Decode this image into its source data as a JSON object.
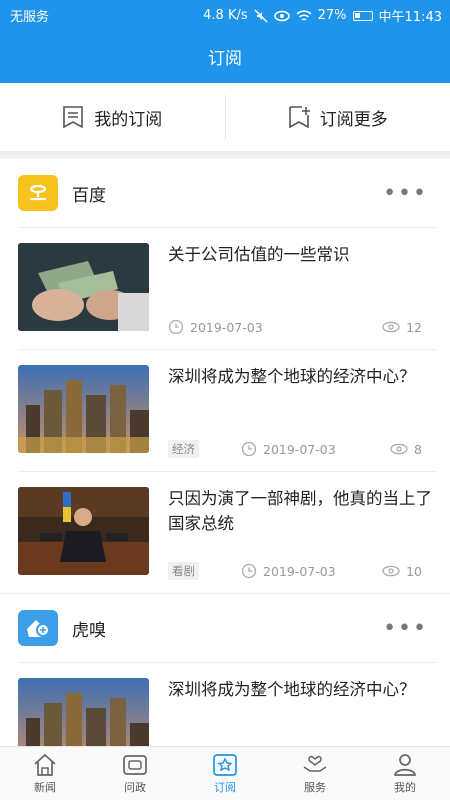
{
  "status": {
    "carrier": "无服务",
    "speed": "4.8 K/s",
    "battery": "27%",
    "time": "中午11:43"
  },
  "header": {
    "title": "订阅"
  },
  "subtabs": [
    {
      "label": "我的订阅",
      "icon": "bookmark-list-icon"
    },
    {
      "label": "订阅更多",
      "icon": "bookmark-plus-icon"
    }
  ],
  "sections": [
    {
      "name": "百度",
      "logo_color": "#f6c21b",
      "articles": [
        {
          "title": "关于公司估值的一些常识",
          "tag": "",
          "date": "2019-07-03",
          "views": "12"
        },
        {
          "title": "深圳将成为整个地球的经济中心？",
          "tag": "经济",
          "date": "2019-07-03",
          "views": "8"
        },
        {
          "title": "只因为演了一部神剧，他真的当上了国家总统",
          "tag": "看剧",
          "date": "2019-07-03",
          "views": "10"
        }
      ]
    },
    {
      "name": "虎嗅",
      "logo_color": "#3c9ee8",
      "articles": [
        {
          "title": "深圳将成为整个地球的经济中心？",
          "tag": "",
          "date": "",
          "views": ""
        }
      ]
    }
  ],
  "nav": [
    {
      "label": "新闻",
      "icon": "house-icon"
    },
    {
      "label": "问政",
      "icon": "chat-box-icon"
    },
    {
      "label": "订阅",
      "icon": "subscribe-icon",
      "active": true
    },
    {
      "label": "服务",
      "icon": "heart-hands-icon"
    },
    {
      "label": "我的",
      "icon": "person-icon"
    }
  ],
  "colors": {
    "brand": "#1e94ea"
  }
}
